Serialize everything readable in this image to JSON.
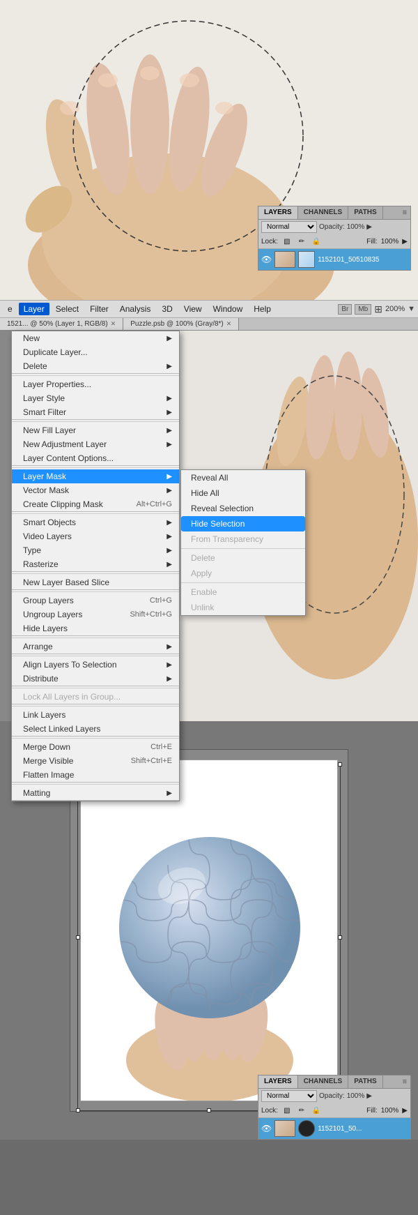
{
  "topPhoto": {
    "altText": "Hand with circular selection"
  },
  "layersPanelTop": {
    "tabs": [
      "LAYERS",
      "CHANNELS",
      "PATHS"
    ],
    "activeTab": "LAYERS",
    "blendMode": "Normal",
    "opacity": "100%",
    "fill": "100%",
    "lockLabel": "Lock:",
    "opacityLabel": "Opacity:",
    "fillLabel": "Fill:",
    "layerName": "1152101_50510835"
  },
  "menuBar": {
    "items": [
      "e",
      "Layer",
      "Select",
      "Filter",
      "Analysis",
      "3D",
      "View",
      "Window",
      "Help"
    ],
    "activeItem": "Layer",
    "rightItems": [
      "Br",
      "Mb"
    ],
    "zoom": "200%"
  },
  "tabsRow": {
    "tabs": [
      {
        "label": "1521... @ 50% (Layer 1, RGB/8)",
        "active": false
      },
      {
        "label": "Puzzle.psb @ 100% (Gray/8*)",
        "active": false
      }
    ]
  },
  "dropdownMenu": {
    "sections": [
      {
        "items": [
          {
            "label": "New",
            "shortcut": "",
            "hasArrow": true,
            "disabled": false
          },
          {
            "label": "Duplicate Layer...",
            "shortcut": "",
            "hasArrow": false,
            "disabled": false
          },
          {
            "label": "Delete",
            "shortcut": "",
            "hasArrow": true,
            "disabled": false
          }
        ]
      },
      {
        "items": [
          {
            "label": "Layer Properties...",
            "shortcut": "",
            "hasArrow": false,
            "disabled": false
          },
          {
            "label": "Layer Style",
            "shortcut": "",
            "hasArrow": true,
            "disabled": false
          },
          {
            "label": "Smart Filter",
            "shortcut": "",
            "hasArrow": true,
            "disabled": false
          }
        ]
      },
      {
        "items": [
          {
            "label": "New Fill Layer",
            "shortcut": "",
            "hasArrow": true,
            "disabled": false
          },
          {
            "label": "New Adjustment Layer",
            "shortcut": "",
            "hasArrow": true,
            "disabled": false
          },
          {
            "label": "Layer Content Options...",
            "shortcut": "",
            "hasArrow": false,
            "disabled": false
          }
        ]
      },
      {
        "items": [
          {
            "label": "Layer Mask",
            "shortcut": "",
            "hasArrow": true,
            "disabled": false,
            "active": true
          },
          {
            "label": "Vector Mask",
            "shortcut": "",
            "hasArrow": true,
            "disabled": false
          },
          {
            "label": "Create Clipping Mask",
            "shortcut": "Alt+Ctrl+G",
            "hasArrow": false,
            "disabled": false
          }
        ]
      },
      {
        "items": [
          {
            "label": "Smart Objects",
            "shortcut": "",
            "hasArrow": true,
            "disabled": false
          },
          {
            "label": "Video Layers",
            "shortcut": "",
            "hasArrow": true,
            "disabled": false
          },
          {
            "label": "Type",
            "shortcut": "",
            "hasArrow": true,
            "disabled": false
          },
          {
            "label": "Rasterize",
            "shortcut": "",
            "hasArrow": true,
            "disabled": false
          }
        ]
      },
      {
        "items": [
          {
            "label": "New Layer Based Slice",
            "shortcut": "",
            "hasArrow": false,
            "disabled": false
          }
        ]
      },
      {
        "items": [
          {
            "label": "Group Layers",
            "shortcut": "Ctrl+G",
            "hasArrow": false,
            "disabled": false
          },
          {
            "label": "Ungroup Layers",
            "shortcut": "Shift+Ctrl+G",
            "hasArrow": false,
            "disabled": false
          },
          {
            "label": "Hide Layers",
            "shortcut": "",
            "hasArrow": false,
            "disabled": false
          }
        ]
      },
      {
        "items": [
          {
            "label": "Arrange",
            "shortcut": "",
            "hasArrow": true,
            "disabled": false
          }
        ]
      },
      {
        "items": [
          {
            "label": "Align Layers To Selection",
            "shortcut": "",
            "hasArrow": true,
            "disabled": false
          },
          {
            "label": "Distribute",
            "shortcut": "",
            "hasArrow": true,
            "disabled": false
          }
        ]
      },
      {
        "items": [
          {
            "label": "Lock All Layers in Group...",
            "shortcut": "",
            "hasArrow": false,
            "disabled": true
          }
        ]
      },
      {
        "items": [
          {
            "label": "Link Layers",
            "shortcut": "",
            "hasArrow": false,
            "disabled": false
          },
          {
            "label": "Select Linked Layers",
            "shortcut": "",
            "hasArrow": false,
            "disabled": false
          }
        ]
      },
      {
        "items": [
          {
            "label": "Merge Down",
            "shortcut": "Ctrl+E",
            "hasArrow": false,
            "disabled": false
          },
          {
            "label": "Merge Visible",
            "shortcut": "Shift+Ctrl+E",
            "hasArrow": false,
            "disabled": false
          },
          {
            "label": "Flatten Image",
            "shortcut": "",
            "hasArrow": false,
            "disabled": false
          }
        ]
      },
      {
        "items": [
          {
            "label": "Matting",
            "shortcut": "",
            "hasArrow": true,
            "disabled": false
          }
        ]
      }
    ]
  },
  "submenu": {
    "items": [
      {
        "label": "Reveal All",
        "disabled": false,
        "highlighted": false
      },
      {
        "label": "Hide All",
        "disabled": false,
        "highlighted": false
      },
      {
        "label": "Reveal Selection",
        "disabled": false,
        "highlighted": false
      },
      {
        "label": "Hide Selection",
        "disabled": false,
        "highlighted": true
      },
      {
        "label": "From Transparency",
        "disabled": true,
        "highlighted": false
      },
      {
        "label": "Delete",
        "disabled": true,
        "highlighted": false
      },
      {
        "label": "Apply",
        "disabled": true,
        "highlighted": false
      },
      {
        "label": "Enable",
        "disabled": true,
        "highlighted": false
      },
      {
        "label": "Unlink",
        "disabled": true,
        "highlighted": false
      }
    ]
  },
  "bottomSection": {
    "puzzleBall": {
      "altText": "Puzzle sphere held by hand"
    }
  },
  "layersPanelBottom": {
    "tabs": [
      "LAYERS",
      "CHANNELS",
      "PATHS"
    ],
    "activeTab": "LAYERS",
    "blendMode": "Normal",
    "opacity": "100%",
    "fill": "100%",
    "lockLabel": "Lock:",
    "opacityLabel": "Opacity:",
    "fillLabel": "Fill:",
    "layerName": "1152101_50..."
  }
}
